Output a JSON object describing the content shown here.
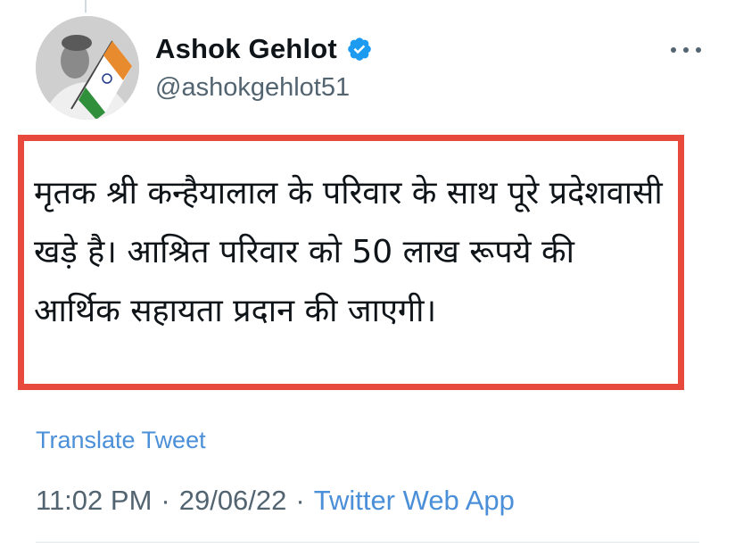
{
  "author": {
    "display_name": "Ashok Gehlot",
    "handle": "@ashokgehlot51",
    "verified": true,
    "avatar_icon": "profile-photo-with-indian-flag"
  },
  "tweet": {
    "text": "मृतक श्री कन्हैयालाल के परिवार के साथ पूरे प्रदेशवासी खड़े है। आश्रित परिवार को 50 लाख रूपये की आर्थिक सहायता प्रदान की जाएगी।",
    "translate_label": "Translate Tweet",
    "time": "11:02 PM",
    "separator": "·",
    "date": "29/06/22",
    "source": "Twitter Web App"
  },
  "colors": {
    "highlight_border": "#e8493d",
    "link": "#4a8fd8",
    "verified_badge": "#1d9bf0",
    "secondary_text": "#536471"
  },
  "icons": {
    "verified": "verified-badge-icon",
    "more": "more-options-icon"
  }
}
